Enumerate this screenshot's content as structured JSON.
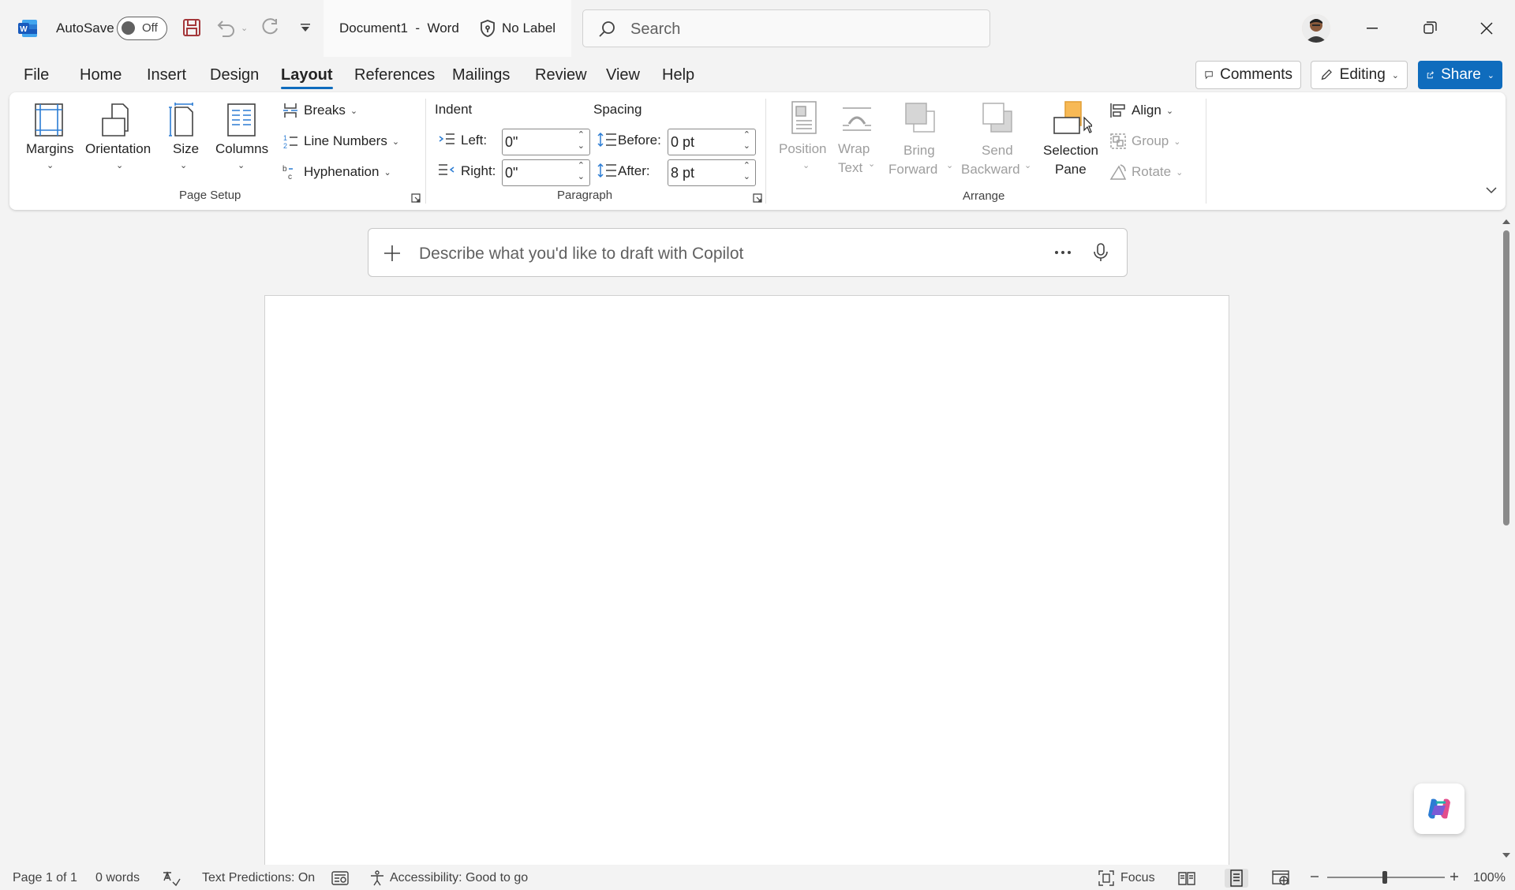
{
  "titlebar": {
    "autosave_label": "AutoSave",
    "autosave_state": "Off",
    "doc_title": "Document1  -  Word",
    "sensitivity_label": "No Label",
    "search_placeholder": "Search"
  },
  "menu": [
    "File",
    "Home",
    "Insert",
    "Design",
    "Layout",
    "References",
    "Mailings",
    "Review",
    "View",
    "Help"
  ],
  "active_tab": "Layout",
  "actions": {
    "comments": "Comments",
    "editing": "Editing",
    "share": "Share"
  },
  "page_setup": {
    "margins": "Margins",
    "orientation": "Orientation",
    "size": "Size",
    "columns": "Columns",
    "breaks": "Breaks",
    "line_numbers": "Line Numbers",
    "hyphenation": "Hyphenation",
    "group_label": "Page Setup"
  },
  "paragraph": {
    "indent_label": "Indent",
    "spacing_label": "Spacing",
    "left_label": "Left:",
    "left_value": "0\"",
    "right_label": "Right:",
    "right_value": "0\"",
    "before_label": "Before:",
    "before_value": "0 pt",
    "after_label": "After:",
    "after_value": "8 pt",
    "group_label": "Paragraph"
  },
  "arrange": {
    "position": "Position",
    "wrap_text_1": "Wrap",
    "wrap_text_2": "Text",
    "bring_forward_1": "Bring",
    "bring_forward_2": "Forward",
    "send_backward_1": "Send",
    "send_backward_2": "Backward",
    "selection_pane_1": "Selection",
    "selection_pane_2": "Pane",
    "align": "Align",
    "group": "Group",
    "rotate": "Rotate",
    "group_label": "Arrange"
  },
  "copilot": {
    "placeholder": "Describe what you'd like to draft with Copilot"
  },
  "status": {
    "page": "Page 1 of 1",
    "words": "0 words",
    "text_predictions": "Text Predictions: On",
    "accessibility": "Accessibility: Good to go",
    "focus": "Focus",
    "zoom": "100%"
  },
  "colors": {
    "accent": "#0f6cbd",
    "word_blue": "#185abd",
    "save_purple": "#a4373a"
  }
}
